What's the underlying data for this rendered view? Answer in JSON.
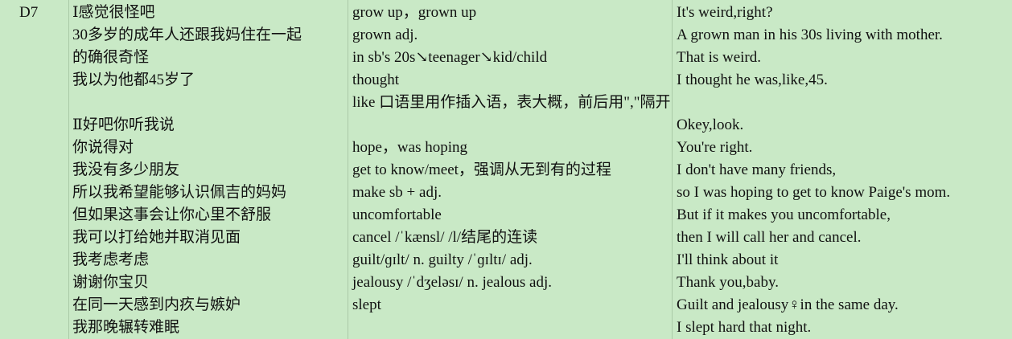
{
  "rows": [
    {
      "day": "D7",
      "chinese": "Ⅰ感觉很怪吧",
      "notes": "grow up，grown up",
      "english": "It's weird,right?"
    },
    {
      "day": "",
      "chinese": "30多岁的成年人还跟我妈住在一起",
      "notes": "grown adj.",
      "english": "A grown man in his 30s living with mother."
    },
    {
      "day": "",
      "chinese": "的确很奇怪",
      "notes": "in sb's 20s↘teenager↘kid/child",
      "english": "That is weird."
    },
    {
      "day": "",
      "chinese": "我以为他都45岁了",
      "notes": "thought",
      "english": "I thought he was,like,45."
    },
    {
      "day": "",
      "chinese": "",
      "notes": "like 口语里用作插入语，表大概，前后用\",\"隔开",
      "english": ""
    },
    {
      "day": "",
      "chinese": "Ⅱ好吧你听我说",
      "notes": "",
      "english": "Okey,look."
    },
    {
      "day": "",
      "chinese": "你说得对",
      "notes": "hope，was hoping",
      "english": "You're right."
    },
    {
      "day": "",
      "chinese": "我没有多少朋友",
      "notes": "get to know/meet，强调从无到有的过程",
      "english": "I don't have many friends,"
    },
    {
      "day": "",
      "chinese": "所以我希望能够认识佩吉的妈妈",
      "notes": "make sb + adj.",
      "english": "so I was hoping to get to know Paige's mom."
    },
    {
      "day": "",
      "chinese": "但如果这事会让你心里不舒服",
      "notes": "uncomfortable",
      "english": "But if it makes you uncomfortable,"
    },
    {
      "day": "",
      "chinese": "我可以打给她并取消见面",
      "notes": "cancel /ˈkænsl/ /l/结尾的连读",
      "english": "then I will call her and cancel."
    },
    {
      "day": "",
      "chinese": "我考虑考虑",
      "notes": "guilt/ɡɪlt/ n. guilty /ˈɡɪltɪ/ adj.",
      "english": "I'll think about it"
    },
    {
      "day": "",
      "chinese": "谢谢你宝贝",
      "notes": "jealousy /ˈdʒeləsɪ/ n. jealous adj.",
      "english": "Thank you,baby."
    },
    {
      "day": "",
      "chinese": "在同一天感到内疚与嫉妒",
      "notes": "slept",
      "english": "Guilt and jealousy♀in the same day."
    },
    {
      "day": "",
      "chinese": "我那晚辗转难眠",
      "notes": "",
      "english": "I slept hard that night."
    }
  ]
}
